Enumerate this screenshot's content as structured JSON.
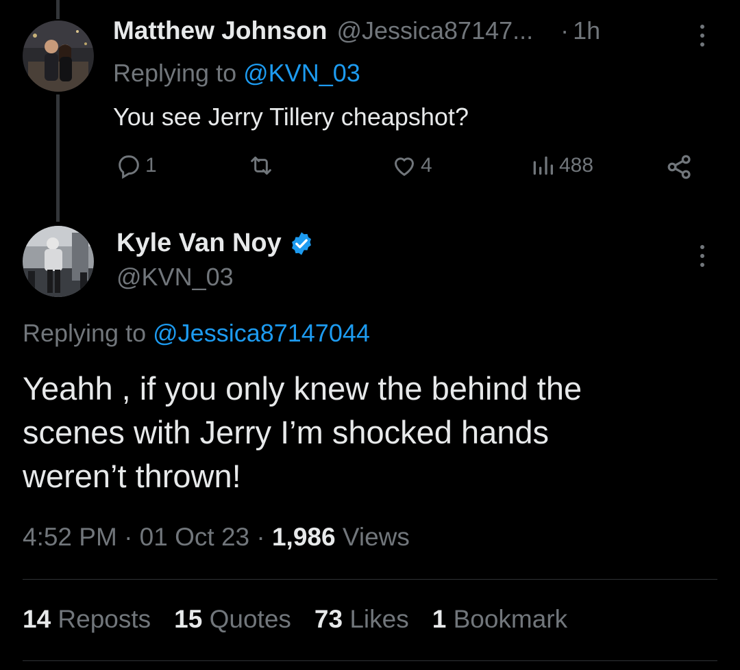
{
  "parent_tweet": {
    "author_name": "Matthew Johnson",
    "handle": "@Jessica87147...",
    "separator": "·",
    "time_ago": "1h",
    "replying_prefix": "Replying to",
    "replying_to": "@KVN_03",
    "text": "You see Jerry Tillery cheapshot?",
    "actions": {
      "reply_count": "1",
      "repost_count": "",
      "like_count": "4",
      "view_count": "488"
    }
  },
  "main_tweet": {
    "author_name": "Kyle Van Noy",
    "handle": "@KVN_03",
    "verified": true,
    "replying_prefix": "Replying to",
    "replying_to": "@Jessica87147044",
    "text_lines": [
      "Yeahh , if you only knew the behind the",
      "scenes with Jerry I’m shocked hands",
      "weren’t thrown!"
    ],
    "timestamp": "4:52 PM · 01 Oct 23 · ",
    "views_count": "1,986",
    "views_label": " Views",
    "stats": {
      "reposts_count": "14",
      "reposts_label": " Reposts",
      "quotes_count": "15",
      "quotes_label": " Quotes",
      "likes_count": "73",
      "likes_label": " Likes",
      "bookmarks_count": "1",
      "bookmarks_label": " Bookmark"
    }
  },
  "icons": {
    "reply": "reply-icon",
    "repost": "repost-icon",
    "like": "heart-icon",
    "views": "views-icon",
    "share": "share-icon",
    "more": "more-options-icon",
    "verified": "verified-badge-icon"
  },
  "colors": {
    "background": "#000000",
    "primary_text": "#e7e9ea",
    "secondary_text": "#71767b",
    "accent": "#1d9bf0",
    "divider": "#2f3336"
  }
}
